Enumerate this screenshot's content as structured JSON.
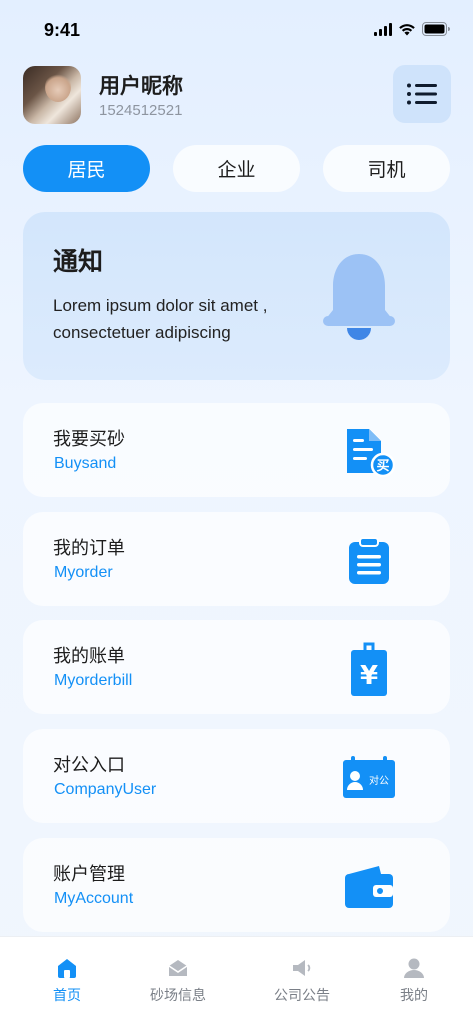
{
  "status_bar": {
    "time": "9:41"
  },
  "profile": {
    "nickname": "用户昵称",
    "phone": "1524512521"
  },
  "tabs": [
    {
      "label": "居民",
      "active": true
    },
    {
      "label": "企业",
      "active": false
    },
    {
      "label": "司机",
      "active": false
    }
  ],
  "notice": {
    "title": "通知",
    "text": "Lorem ipsum dolor sit amet , consectetuer adipiscing"
  },
  "menu": [
    {
      "label": "我要买砂",
      "sub": "Buysand",
      "icon": "buy-document-icon",
      "badge": "买"
    },
    {
      "label": "我的订单",
      "sub": "Myorder",
      "icon": "clipboard-icon"
    },
    {
      "label": "我的账单",
      "sub": "Myorderbill",
      "icon": "yuan-bill-icon",
      "badge": "¥"
    },
    {
      "label": "对公入口",
      "sub": "CompanyUser",
      "icon": "company-card-icon",
      "badge": "对公"
    },
    {
      "label": "账户管理",
      "sub": "MyAccount",
      "icon": "wallet-icon"
    }
  ],
  "tabbar": [
    {
      "label": "首页",
      "icon": "home-icon",
      "active": true
    },
    {
      "label": "砂场信息",
      "icon": "mail-icon",
      "active": false
    },
    {
      "label": "公司公告",
      "icon": "speaker-icon",
      "active": false
    },
    {
      "label": "我的",
      "icon": "user-icon",
      "active": false
    }
  ],
  "colors": {
    "accent": "#1390f6",
    "notice_bg": "#d3e6fc",
    "bell": "#9cc2f5"
  }
}
